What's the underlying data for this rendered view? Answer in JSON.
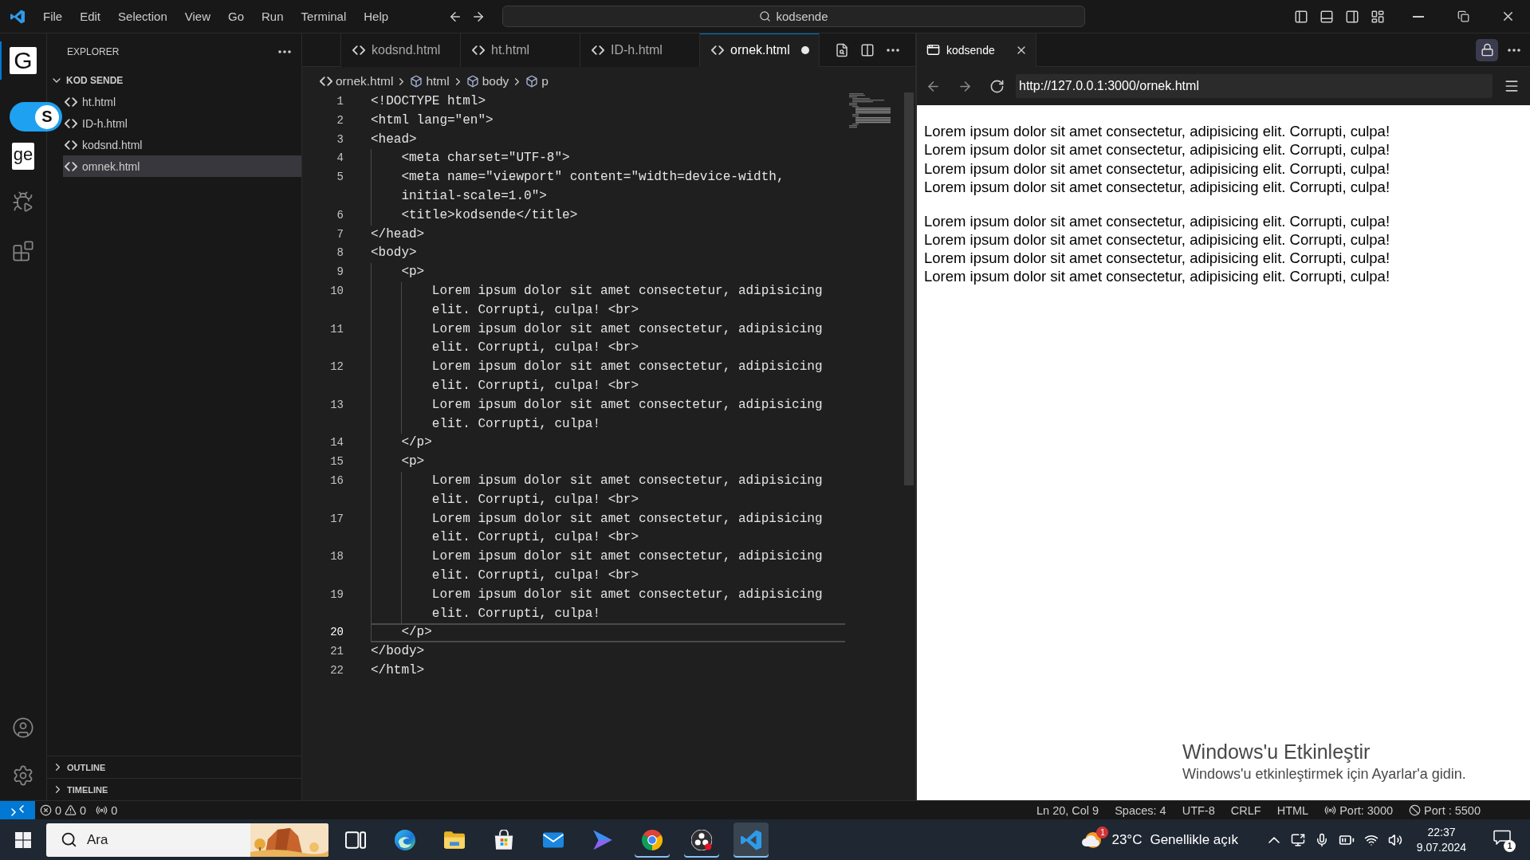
{
  "title_bar": {
    "menu": [
      "File",
      "Edit",
      "Selection",
      "View",
      "Go",
      "Run",
      "Terminal",
      "Help"
    ],
    "command_center": {
      "label": "kodsende"
    }
  },
  "activity_bar": {
    "items": [
      {
        "label": "G",
        "selected": true
      },
      {
        "label": "ge",
        "selected": false
      }
    ]
  },
  "floating_button": {
    "label": "S"
  },
  "sidebar": {
    "title": "EXPLORER",
    "folder": {
      "name": "KOD SENDE",
      "expanded": true
    },
    "files": [
      {
        "name": "ht.html",
        "selected": false
      },
      {
        "name": "ID-h.html",
        "selected": false
      },
      {
        "name": "kodsnd.html",
        "selected": false
      },
      {
        "name": "omnek.html",
        "selected": true
      }
    ],
    "sections": [
      {
        "name": "OUTLINE",
        "expanded": false
      },
      {
        "name": "TIMELINE",
        "expanded": false
      }
    ]
  },
  "editor": {
    "tabs": [
      {
        "name": "kodsnd.html",
        "selected": false,
        "modified": false
      },
      {
        "name": "ht.html",
        "selected": false,
        "modified": false
      },
      {
        "name": "ID-h.html",
        "selected": false,
        "modified": false
      },
      {
        "name": "ornek.html",
        "selected": true,
        "modified": true
      }
    ],
    "breadcrumb": [
      {
        "kind": "file",
        "label": "ornek.html"
      },
      {
        "kind": "element",
        "label": "html"
      },
      {
        "kind": "element",
        "label": "body"
      },
      {
        "kind": "element",
        "label": "p"
      }
    ],
    "lines": [
      {
        "number": "1",
        "code": "<!DOCTYPE html>",
        "current": false
      },
      {
        "number": "2",
        "code": "<html lang=\"en\">",
        "current": false
      },
      {
        "number": "3",
        "code": "<head>",
        "current": false
      },
      {
        "number": "4",
        "code": "    <meta charset=\"UTF-8\">",
        "current": false
      },
      {
        "number": "5",
        "code": "    <meta name=\"viewport\" content=\"width=device-width, initial-scale=1.0\">",
        "current": false
      },
      {
        "number": "6",
        "code": "    <title>kodsende</title>",
        "current": false
      },
      {
        "number": "7",
        "code": "</head>",
        "current": false
      },
      {
        "number": "8",
        "code": "<body>",
        "current": false
      },
      {
        "number": "9",
        "code": "    <p>",
        "current": false
      },
      {
        "number": "10",
        "code": "        Lorem ipsum dolor sit amet consectetur, adipisicing elit. Corrupti, culpa! <br>",
        "current": false
      },
      {
        "number": "11",
        "code": "        Lorem ipsum dolor sit amet consectetur, adipisicing elit. Corrupti, culpa! <br>",
        "current": false
      },
      {
        "number": "12",
        "code": "        Lorem ipsum dolor sit amet consectetur, adipisicing elit. Corrupti, culpa! <br>",
        "current": false
      },
      {
        "number": "13",
        "code": "        Lorem ipsum dolor sit amet consectetur, adipisicing elit. Corrupti, culpa!",
        "current": false
      },
      {
        "number": "14",
        "code": "    </p>",
        "current": false
      },
      {
        "number": "15",
        "code": "    <p>",
        "current": false
      },
      {
        "number": "16",
        "code": "        Lorem ipsum dolor sit amet consectetur, adipisicing elit. Corrupti, culpa! <br>",
        "current": false
      },
      {
        "number": "17",
        "code": "        Lorem ipsum dolor sit amet consectetur, adipisicing elit. Corrupti, culpa! <br>",
        "current": false
      },
      {
        "number": "18",
        "code": "        Lorem ipsum dolor sit amet consectetur, adipisicing elit. Corrupti, culpa! <br>",
        "current": false
      },
      {
        "number": "19",
        "code": "        Lorem ipsum dolor sit amet consectetur, adipisicing elit. Corrupti, culpa!",
        "current": false
      },
      {
        "number": "20",
        "code": "    </p>",
        "current": true
      },
      {
        "number": "21",
        "code": "</body>",
        "current": false
      },
      {
        "number": "22",
        "code": "</html>",
        "current": false
      }
    ]
  },
  "preview": {
    "tab": {
      "title": "kodsende"
    },
    "url": "http://127.0.0.1:3000/ornek.html",
    "paragraphs": [
      {
        "lines": [
          "Lorem ipsum dolor sit amet consectetur, adipisicing elit. Corrupti, culpa!",
          "Lorem ipsum dolor sit amet consectetur, adipisicing elit. Corrupti, culpa!",
          "Lorem ipsum dolor sit amet consectetur, adipisicing elit. Corrupti, culpa!",
          "Lorem ipsum dolor sit amet consectetur, adipisicing elit. Corrupti, culpa!"
        ]
      },
      {
        "lines": [
          "Lorem ipsum dolor sit amet consectetur, adipisicing elit. Corrupti, culpa!",
          "Lorem ipsum dolor sit amet consectetur, adipisicing elit. Corrupti, culpa!",
          "Lorem ipsum dolor sit amet consectetur, adipisicing elit. Corrupti, culpa!",
          "Lorem ipsum dolor sit amet consectetur, adipisicing elit. Corrupti, culpa!"
        ]
      }
    ]
  },
  "activation_notice": {
    "title": "Windows'u Etkinleştir",
    "text": "Windows'u etkinleştirmek için Ayarlar'a gidin."
  },
  "status_bar": {
    "errors": "0",
    "warnings": "0",
    "ports": "0",
    "items": [
      {
        "kind": "text",
        "label": "Ln 20, Col 9"
      },
      {
        "kind": "text",
        "label": "Spaces: 4"
      },
      {
        "kind": "text",
        "label": "UTF-8"
      },
      {
        "kind": "text",
        "label": "CRLF"
      },
      {
        "kind": "text",
        "label": "HTML"
      },
      {
        "kind": "broadcast",
        "label": "Port: 3000"
      },
      {
        "kind": "blocked",
        "label": "Port : 5500"
      }
    ]
  },
  "taskbar": {
    "search": {
      "placeholder": "Ara"
    },
    "apps": [
      {
        "kind": "taskview",
        "selected": false,
        "running": false
      },
      {
        "kind": "swirl",
        "selected": false,
        "running": false
      },
      {
        "kind": "folder",
        "selected": false,
        "running": false
      },
      {
        "kind": "bag",
        "selected": false,
        "running": false
      },
      {
        "kind": "mail",
        "selected": false,
        "running": false
      },
      {
        "kind": "prism",
        "selected": false,
        "running": false
      },
      {
        "kind": "wheel",
        "selected": false,
        "running": true
      },
      {
        "kind": "lens",
        "selected": false,
        "running": true
      },
      {
        "kind": "ribbon",
        "selected": true,
        "running": true
      }
    ],
    "weather": {
      "badge": "1",
      "temperature": "23°C",
      "condition": "Genellikle açık"
    },
    "clock": {
      "time": "22:37",
      "date": "9.07.2024"
    },
    "notifications": {
      "count": "1"
    }
  }
}
